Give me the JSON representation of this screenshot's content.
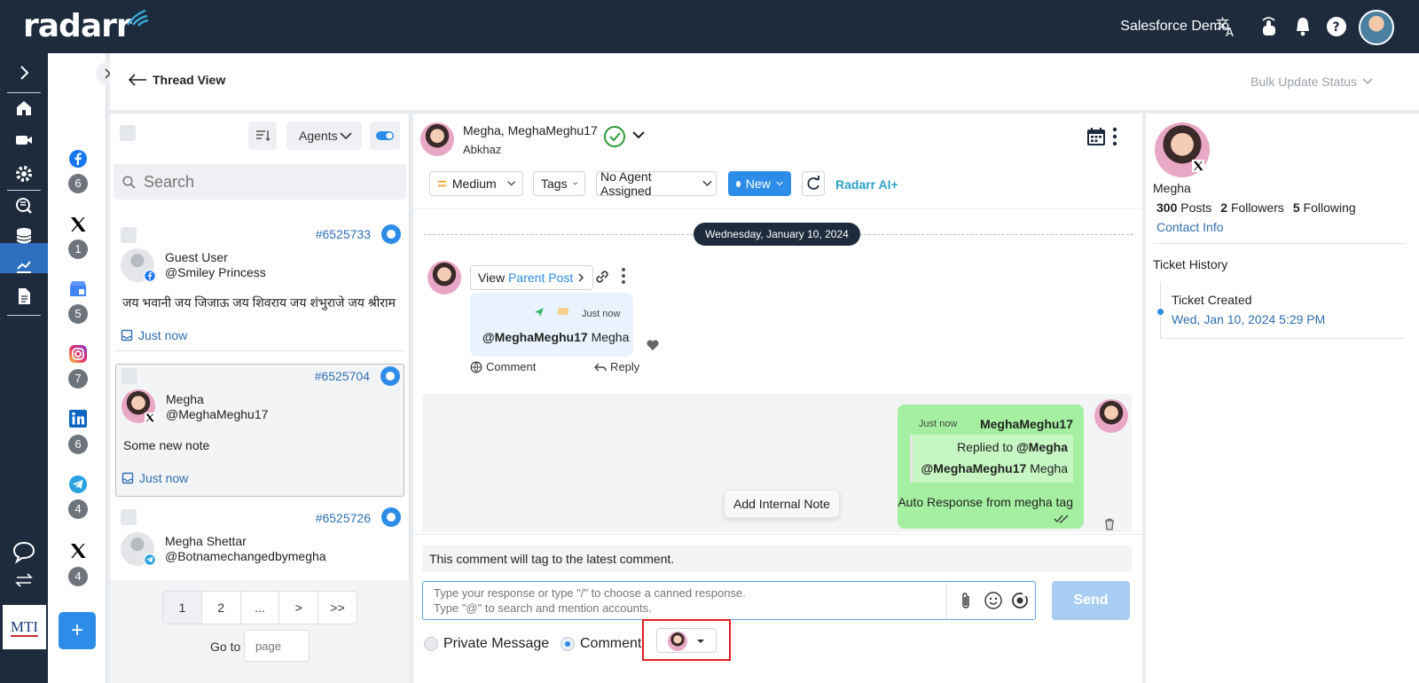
{
  "app": {
    "logo_text": "radarr",
    "account_name": "Salesforce Demo",
    "top_icons": [
      "translate-icon",
      "touch-icon",
      "bell-icon",
      "help-icon"
    ],
    "org_logo_text": "MTI"
  },
  "nav": {
    "icons": [
      "expand-icon",
      "home-icon",
      "video-icon",
      "settings-icon",
      "inbox-icon",
      "database-icon",
      "analytics-icon",
      "document-icon",
      "chat-icon",
      "swap-icon"
    ]
  },
  "channels": [
    {
      "icon": "facebook-icon",
      "count": "6"
    },
    {
      "icon": "x-icon",
      "count": "1"
    },
    {
      "icon": "google-business-icon",
      "count": "5"
    },
    {
      "icon": "instagram-icon",
      "count": "7"
    },
    {
      "icon": "linkedin-icon",
      "count": "6"
    },
    {
      "icon": "telegram-icon",
      "count": "4"
    },
    {
      "icon": "x-icon",
      "count": "4"
    }
  ],
  "header": {
    "back_label": "Thread View",
    "bulk_label": "Bulk Update Status"
  },
  "list": {
    "agents_label": "Agents",
    "search_placeholder": "Search",
    "tickets": [
      {
        "id": "#6525733",
        "name": "Guest User",
        "handle": "@Smiley Princess",
        "body": "जय भवानी जय जिजाऊ जय शिवराय जय शंभुराजे जय श्रीराम",
        "time": "Just now",
        "channel": "facebook"
      },
      {
        "id": "#6525704",
        "name": "Megha",
        "handle": "@MeghaMeghu17",
        "body": "Some new note",
        "time": "Just now",
        "channel": "x"
      },
      {
        "id": "#6525726",
        "name": "Megha Shettar",
        "handle": "@Botnamechangedbymegha",
        "body": "",
        "time": "",
        "channel": "telegram"
      }
    ],
    "pagination": [
      "1",
      "2",
      "...",
      ">",
      ">>"
    ],
    "goto_label": "Go to",
    "goto_placeholder": "page"
  },
  "conversation": {
    "title": "Megha, MeghaMeghu17",
    "location": "Abkhaz",
    "priority": "Medium",
    "tags_label": "Tags",
    "agent_label": "No Agent Assigned",
    "status_label": "New",
    "ai_label": "Radarr AI+",
    "date_label": "Wednesday, January 10, 2024",
    "view_label": "View",
    "parent_post_label": "Parent Post",
    "incoming": {
      "time": "Just now",
      "handle": "@MeghaMeghu17",
      "name": "Megha"
    },
    "comment_label": "Comment",
    "reply_label": "Reply",
    "outgoing": {
      "time": "Just now",
      "author": "MeghaMeghu17",
      "replied_to_prefix": "Replied to",
      "replied_to_name": "@Megha",
      "quote_handle": "@MeghaMeghu17",
      "quote_name": "Megha",
      "text": "Auto Response from megha tag"
    },
    "tooltip": "Add Internal Note",
    "tag_note": "This comment will tag to the latest comment.",
    "reply_placeholder": "Type your response or type \"/\" to choose a canned response.\nType \"@\" to search and mention accounts.",
    "send_label": "Send",
    "private_label": "Private Message",
    "comment_option_label": "Comment"
  },
  "profile": {
    "name": "Megha",
    "posts": "300",
    "posts_label": "Posts",
    "followers": "2",
    "followers_label": "Followers",
    "following": "5",
    "following_label": "Following",
    "contact_label": "Contact Info",
    "history_label": "Ticket History",
    "created_label": "Ticket Created",
    "created_date": "Wed, Jan 10, 2024 5:29 PM"
  },
  "colors": {
    "header_bg": "#1d2b3c",
    "accent": "#2d8ce8",
    "outgoing_bubble": "#a4f0a0",
    "incoming_bubble": "#e8f3fd",
    "highlight": "#e02020"
  }
}
